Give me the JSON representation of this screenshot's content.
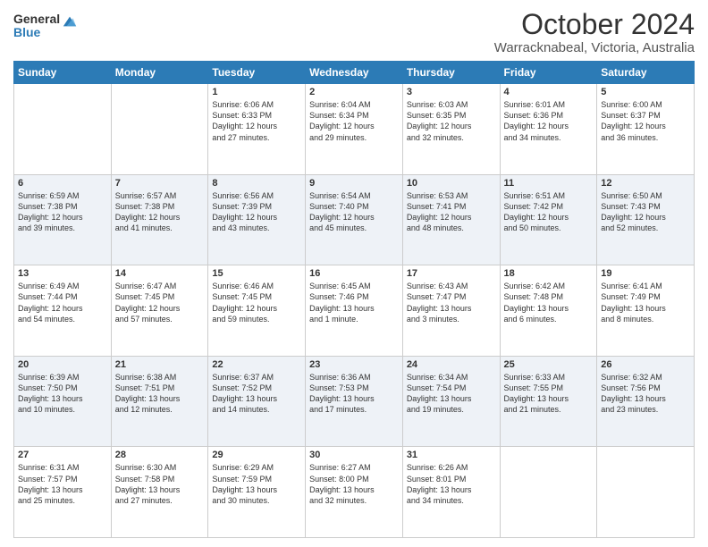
{
  "header": {
    "logo_general": "General",
    "logo_blue": "Blue",
    "month": "October 2024",
    "location": "Warracknabeal, Victoria, Australia"
  },
  "days_of_week": [
    "Sunday",
    "Monday",
    "Tuesday",
    "Wednesday",
    "Thursday",
    "Friday",
    "Saturday"
  ],
  "weeks": [
    [
      {
        "day": "",
        "info": ""
      },
      {
        "day": "",
        "info": ""
      },
      {
        "day": "1",
        "info": "Sunrise: 6:06 AM\nSunset: 6:33 PM\nDaylight: 12 hours\nand 27 minutes."
      },
      {
        "day": "2",
        "info": "Sunrise: 6:04 AM\nSunset: 6:34 PM\nDaylight: 12 hours\nand 29 minutes."
      },
      {
        "day": "3",
        "info": "Sunrise: 6:03 AM\nSunset: 6:35 PM\nDaylight: 12 hours\nand 32 minutes."
      },
      {
        "day": "4",
        "info": "Sunrise: 6:01 AM\nSunset: 6:36 PM\nDaylight: 12 hours\nand 34 minutes."
      },
      {
        "day": "5",
        "info": "Sunrise: 6:00 AM\nSunset: 6:37 PM\nDaylight: 12 hours\nand 36 minutes."
      }
    ],
    [
      {
        "day": "6",
        "info": "Sunrise: 6:59 AM\nSunset: 7:38 PM\nDaylight: 12 hours\nand 39 minutes."
      },
      {
        "day": "7",
        "info": "Sunrise: 6:57 AM\nSunset: 7:38 PM\nDaylight: 12 hours\nand 41 minutes."
      },
      {
        "day": "8",
        "info": "Sunrise: 6:56 AM\nSunset: 7:39 PM\nDaylight: 12 hours\nand 43 minutes."
      },
      {
        "day": "9",
        "info": "Sunrise: 6:54 AM\nSunset: 7:40 PM\nDaylight: 12 hours\nand 45 minutes."
      },
      {
        "day": "10",
        "info": "Sunrise: 6:53 AM\nSunset: 7:41 PM\nDaylight: 12 hours\nand 48 minutes."
      },
      {
        "day": "11",
        "info": "Sunrise: 6:51 AM\nSunset: 7:42 PM\nDaylight: 12 hours\nand 50 minutes."
      },
      {
        "day": "12",
        "info": "Sunrise: 6:50 AM\nSunset: 7:43 PM\nDaylight: 12 hours\nand 52 minutes."
      }
    ],
    [
      {
        "day": "13",
        "info": "Sunrise: 6:49 AM\nSunset: 7:44 PM\nDaylight: 12 hours\nand 54 minutes."
      },
      {
        "day": "14",
        "info": "Sunrise: 6:47 AM\nSunset: 7:45 PM\nDaylight: 12 hours\nand 57 minutes."
      },
      {
        "day": "15",
        "info": "Sunrise: 6:46 AM\nSunset: 7:45 PM\nDaylight: 12 hours\nand 59 minutes."
      },
      {
        "day": "16",
        "info": "Sunrise: 6:45 AM\nSunset: 7:46 PM\nDaylight: 13 hours\nand 1 minute."
      },
      {
        "day": "17",
        "info": "Sunrise: 6:43 AM\nSunset: 7:47 PM\nDaylight: 13 hours\nand 3 minutes."
      },
      {
        "day": "18",
        "info": "Sunrise: 6:42 AM\nSunset: 7:48 PM\nDaylight: 13 hours\nand 6 minutes."
      },
      {
        "day": "19",
        "info": "Sunrise: 6:41 AM\nSunset: 7:49 PM\nDaylight: 13 hours\nand 8 minutes."
      }
    ],
    [
      {
        "day": "20",
        "info": "Sunrise: 6:39 AM\nSunset: 7:50 PM\nDaylight: 13 hours\nand 10 minutes."
      },
      {
        "day": "21",
        "info": "Sunrise: 6:38 AM\nSunset: 7:51 PM\nDaylight: 13 hours\nand 12 minutes."
      },
      {
        "day": "22",
        "info": "Sunrise: 6:37 AM\nSunset: 7:52 PM\nDaylight: 13 hours\nand 14 minutes."
      },
      {
        "day": "23",
        "info": "Sunrise: 6:36 AM\nSunset: 7:53 PM\nDaylight: 13 hours\nand 17 minutes."
      },
      {
        "day": "24",
        "info": "Sunrise: 6:34 AM\nSunset: 7:54 PM\nDaylight: 13 hours\nand 19 minutes."
      },
      {
        "day": "25",
        "info": "Sunrise: 6:33 AM\nSunset: 7:55 PM\nDaylight: 13 hours\nand 21 minutes."
      },
      {
        "day": "26",
        "info": "Sunrise: 6:32 AM\nSunset: 7:56 PM\nDaylight: 13 hours\nand 23 minutes."
      }
    ],
    [
      {
        "day": "27",
        "info": "Sunrise: 6:31 AM\nSunset: 7:57 PM\nDaylight: 13 hours\nand 25 minutes."
      },
      {
        "day": "28",
        "info": "Sunrise: 6:30 AM\nSunset: 7:58 PM\nDaylight: 13 hours\nand 27 minutes."
      },
      {
        "day": "29",
        "info": "Sunrise: 6:29 AM\nSunset: 7:59 PM\nDaylight: 13 hours\nand 30 minutes."
      },
      {
        "day": "30",
        "info": "Sunrise: 6:27 AM\nSunset: 8:00 PM\nDaylight: 13 hours\nand 32 minutes."
      },
      {
        "day": "31",
        "info": "Sunrise: 6:26 AM\nSunset: 8:01 PM\nDaylight: 13 hours\nand 34 minutes."
      },
      {
        "day": "",
        "info": ""
      },
      {
        "day": "",
        "info": ""
      }
    ]
  ]
}
